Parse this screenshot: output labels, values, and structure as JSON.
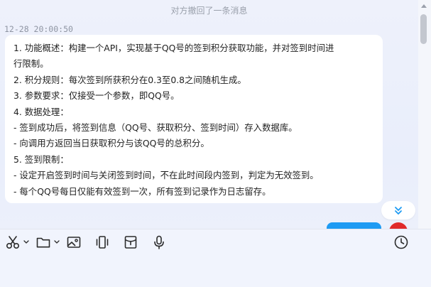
{
  "chat": {
    "recall_notice": "对方撤回了一条消息",
    "timestamp": "12-28 20:00:50",
    "message_lines": [
      "1. 功能概述：构建一个API，实现基于QQ号的签到积分获取功能，并对签到时间进",
      "行限制。",
      "2. 积分规则：每次签到所获积分在0.3至0.8之间随机生成。",
      "3. 参数要求：仅接受一个参数，即QQ号。",
      "4. 数据处理：",
      "- 签到成功后，将签到信息（QQ号、获取积分、签到时间）存入数据库。",
      "- 向调用方返回当日获取积分与该QQ号的总积分。",
      "5. 签到限制：",
      "- 设定开启签到时间与关闭签到时间，不在此时间段内签到，判定为无效签到。",
      "- 每个QQ号每日仅能有效签到一次，所有签到记录作为日志留存。"
    ]
  },
  "toolbar": {
    "icons": [
      "scissors-icon",
      "chevron-down-icon",
      "folder-icon",
      "chevron-down-icon",
      "image-icon",
      "shake-icon",
      "red-packet-icon",
      "microphone-icon",
      "clock-icon"
    ]
  },
  "colors": {
    "accent": "#1e9bf3",
    "avatar": "#e02a2a",
    "scroll_down_arrow": "#1e9bf3"
  }
}
